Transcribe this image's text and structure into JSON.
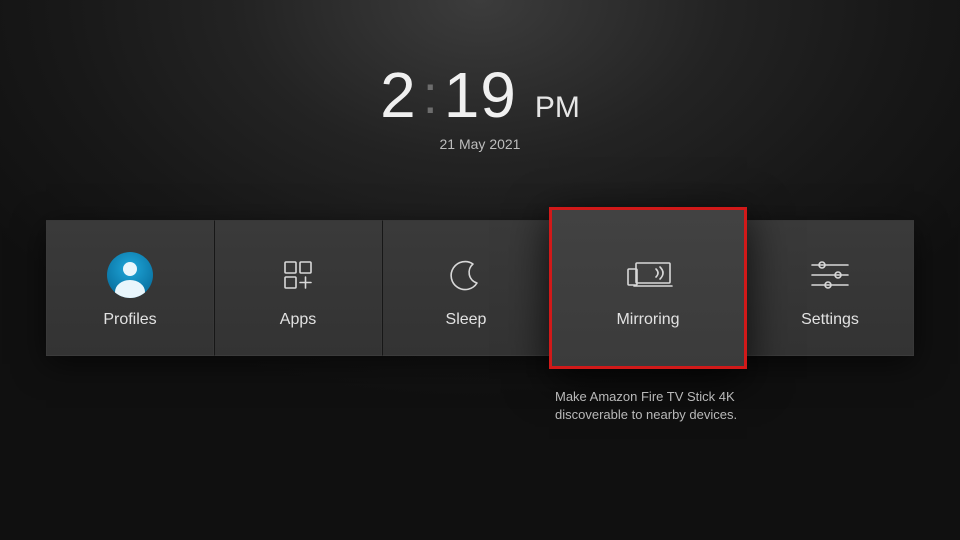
{
  "clock": {
    "hours": "2",
    "minutes": "19",
    "ampm": "PM",
    "date": "21 May 2021"
  },
  "tiles": [
    {
      "id": "profiles",
      "label": "Profiles",
      "hint": "",
      "selected": false
    },
    {
      "id": "apps",
      "label": "Apps",
      "hint": "",
      "selected": false
    },
    {
      "id": "sleep",
      "label": "Sleep",
      "hint": "",
      "selected": false
    },
    {
      "id": "mirroring",
      "label": "Mirroring",
      "hint": "Make Amazon Fire TV Stick 4K discoverable to nearby devices.",
      "selected": true
    },
    {
      "id": "settings",
      "label": "Settings",
      "hint": "",
      "selected": false
    }
  ]
}
